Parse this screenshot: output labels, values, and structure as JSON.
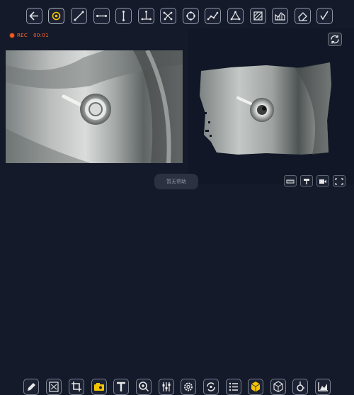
{
  "recording": {
    "label": "REC",
    "time": "00:01"
  },
  "toast": {
    "text": "暂无帮助"
  },
  "top_tools": [
    "back-arrow-icon",
    "point-icon",
    "line-icon",
    "horizontal-segment-icon",
    "vertical-segment-icon",
    "angle-icon",
    "multi-point-icon",
    "circle-fit-icon",
    "polyline-icon",
    "triangle-icon",
    "hatch-area-icon",
    "chart-area-icon",
    "eraser-icon",
    "checkmark-icon"
  ],
  "bottom_tools": [
    "pencil-icon",
    "image-edit-icon",
    "crop-icon",
    "camera-mode-icon",
    "text-icon",
    "zoom-icon",
    "sliders-icon",
    "settings-icon",
    "sync-icon",
    "list-icon",
    "cube-icon",
    "3d-box-icon",
    "probe-icon",
    "chart-icon"
  ],
  "colors": {
    "accent": "#f5c400",
    "rec": "#ff5a1f",
    "background": "#141a2a"
  }
}
